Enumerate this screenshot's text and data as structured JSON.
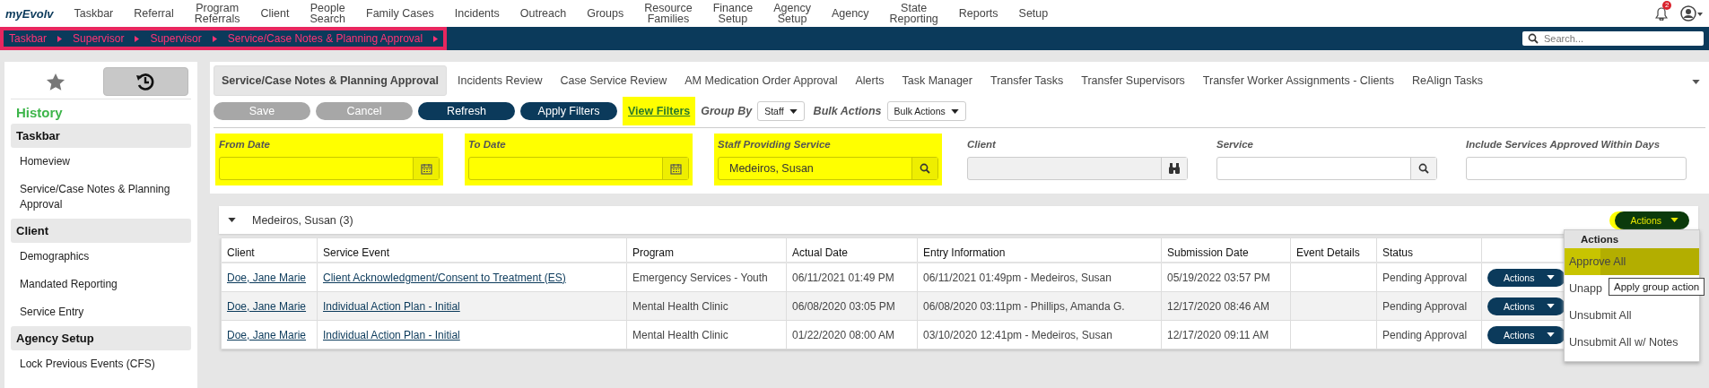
{
  "nav": {
    "logo": "myEvolv",
    "items": [
      "Taskbar",
      "Referral",
      "Program\nReferrals",
      "Client",
      "People\nSearch",
      "Family Cases",
      "Incidents",
      "Outreach",
      "Groups",
      "Resource\nFamilies",
      "Finance\nSetup",
      "Agency\nSetup",
      "Agency",
      "State\nReporting",
      "Reports",
      "Setup"
    ],
    "notification_count": "2"
  },
  "breadcrumb": {
    "highlighted": true,
    "items": [
      "Taskbar",
      "Supervisor",
      "Supervisor",
      "Service/Case Notes & Planning Approval"
    ],
    "search_placeholder": "Search..."
  },
  "sidebar": {
    "toggles": [
      {
        "kind": "star",
        "selected": false
      },
      {
        "kind": "history",
        "selected": true
      }
    ],
    "title": "History",
    "sections": [
      {
        "heading": "Taskbar",
        "items": [
          "Homeview",
          "Service/Case Notes & Planning Approval"
        ]
      },
      {
        "heading": "Client",
        "items": [
          "Demographics",
          "Mandated Reporting",
          "Service Entry"
        ]
      },
      {
        "heading": "Agency Setup",
        "items": [
          "Lock Previous Events (CFS)"
        ]
      }
    ]
  },
  "tabs": [
    {
      "label": "Service/Case Notes & Planning Approval",
      "selected": true
    },
    {
      "label": "Incidents Review",
      "selected": false
    },
    {
      "label": "Case Service Review",
      "selected": false
    },
    {
      "label": "AM Medication Order Approval",
      "selected": false
    },
    {
      "label": "Alerts",
      "selected": false
    },
    {
      "label": "Task Manager",
      "selected": false
    },
    {
      "label": "Transfer Tasks",
      "selected": false
    },
    {
      "label": "Transfer Supervisors",
      "selected": false
    },
    {
      "label": "Transfer Worker Assignments - Clients",
      "selected": false
    },
    {
      "label": "ReAlign Tasks",
      "selected": false
    }
  ],
  "toolbar": {
    "buttons": [
      {
        "label": "Save",
        "disabled": true
      },
      {
        "label": "Cancel",
        "disabled": true
      },
      {
        "label": "Refresh",
        "disabled": false
      },
      {
        "label": "Apply Filters",
        "disabled": false
      }
    ],
    "view_filters": {
      "label": "View Filters",
      "highlighted": true
    },
    "group_by": {
      "label": "Group By",
      "value": "Staff"
    },
    "bulk_actions": {
      "label": "Bulk Actions",
      "value": "Bulk Actions"
    }
  },
  "filters": [
    {
      "label": "From Date",
      "kind": "date",
      "highlighted": true,
      "disabled": false
    },
    {
      "label": "To Date",
      "kind": "date",
      "highlighted": true,
      "disabled": false
    },
    {
      "label": "Staff Providing Service",
      "kind": "search",
      "value": "Medeiros, Susan",
      "highlighted": true,
      "disabled": false
    },
    {
      "label": "Client",
      "kind": "lookup",
      "highlighted": false,
      "disabled": true
    },
    {
      "label": "Service",
      "kind": "search",
      "highlighted": false,
      "disabled": false
    },
    {
      "label": "Include Services Approved Within Days",
      "kind": "text",
      "highlighted": false,
      "disabled": false
    }
  ],
  "group": {
    "title": "Medeiros, Susan (3)",
    "expanded": true,
    "actions_label": "Actions",
    "actions_highlighted": true
  },
  "table": {
    "columns": [
      "Client",
      "Service Event",
      "Program",
      "Actual Date",
      "Entry Information",
      "Submission Date",
      "Event Details",
      "Status"
    ],
    "rows": [
      {
        "client": "Doe, Jane Marie",
        "service_event": "Client Acknowledgment/Consent to Treatment (ES)",
        "program": "Emergency Services - Youth",
        "actual_date": "06/11/2021 01:49 PM",
        "entry_information": "06/11/2021 01:49pm - Medeiros, Susan",
        "submission_date": "05/19/2022 03:57 PM",
        "status": "Pending Approval",
        "action": "Actions"
      },
      {
        "client": "Doe, Jane Marie",
        "service_event": "Individual Action Plan - Initial",
        "program": "Mental Health Clinic",
        "actual_date": "06/08/2020 03:05 PM",
        "entry_information": "06/08/2020 03:11pm - Phillips, Amanda G.",
        "submission_date": "12/17/2020 08:46 AM",
        "status": "Pending Approval",
        "action": "Actions"
      },
      {
        "client": "Doe, Jane Marie",
        "service_event": "Individual Action Plan - Initial",
        "program": "Mental Health Clinic",
        "actual_date": "01/22/2020 08:00 AM",
        "entry_information": "03/10/2020 12:41pm - Medeiros, Susan",
        "submission_date": "12/17/2020 09:11 AM",
        "status": "Pending Approval",
        "action": "Actions"
      }
    ]
  },
  "menu": {
    "title": "Actions",
    "items": [
      {
        "label": "Approve All",
        "selected": true
      },
      {
        "label": "Unapp",
        "selected": false
      },
      {
        "label": "Unsubmit All",
        "selected": false
      },
      {
        "label": "Unsubmit All w/ Notes",
        "selected": false
      }
    ]
  },
  "tooltip": "Apply group action"
}
